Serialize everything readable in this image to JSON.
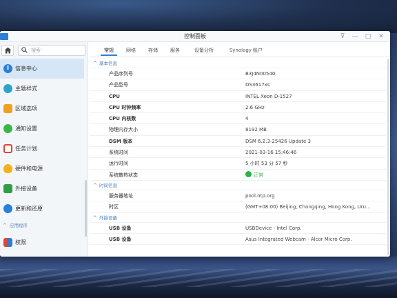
{
  "window": {
    "title": "控制面板",
    "controls": {
      "pin": "⊽",
      "minimize": "—",
      "maximize": "□",
      "close": "✕"
    }
  },
  "sidebar": {
    "search_placeholder": "搜索",
    "items": [
      {
        "label": "信息中心",
        "icon": "info-icon",
        "color": "#2a7fd6",
        "active": true
      },
      {
        "label": "主题样式",
        "icon": "palette-icon",
        "color": "#2ea3c9"
      },
      {
        "label": "区域选项",
        "icon": "region-icon",
        "color": "#f0a020"
      },
      {
        "label": "通知设置",
        "icon": "chat-icon",
        "color": "#3bb54a"
      },
      {
        "label": "任务计划",
        "icon": "calendar-icon",
        "color": "#e0443a"
      },
      {
        "label": "硬件和电源",
        "icon": "bulb-icon",
        "color": "#f3b21b"
      },
      {
        "label": "外接设备",
        "icon": "external-device-icon",
        "color": "#2f9e44"
      },
      {
        "label": "更新和还原",
        "icon": "refresh-icon",
        "color": "#2a7fd6"
      }
    ],
    "section_label": "应用程序",
    "section_items": [
      {
        "label": "权限",
        "icon": "permission-icon",
        "color": "#e0443a"
      }
    ]
  },
  "tabs": [
    "常规",
    "网络",
    "存储",
    "服务",
    "设备分析",
    "Synology 帐户"
  ],
  "active_tab": "常规",
  "sections": [
    {
      "title": "基本信息",
      "rows": [
        {
          "key": "产品序列号",
          "value": "B3J4N00540",
          "bold": false
        },
        {
          "key": "产品型号",
          "value": "DS3617xs",
          "bold": false
        },
        {
          "key": "CPU",
          "value": "INTEL Xeon D-1527",
          "bold": true
        },
        {
          "key": "CPU 时钟频率",
          "value": "2.6 GHz",
          "bold": true
        },
        {
          "key": "CPU 内核数",
          "value": "4",
          "bold": true
        },
        {
          "key": "物理内存大小",
          "value": "8192 MB",
          "bold": false
        },
        {
          "key": "DSM 版本",
          "value": "DSM 6.2.3-25426 Update 3",
          "bold": true
        },
        {
          "key": "系统时间",
          "value": "2021-03-16 15:46:46",
          "bold": false
        },
        {
          "key": "运行时间",
          "value": "5 小时 53 分 57 秒",
          "bold": false
        },
        {
          "key": "系统散热状态",
          "value": "正常",
          "bold": false,
          "status": true
        }
      ]
    },
    {
      "title": "时间信息",
      "rows": [
        {
          "key": "服务器地址",
          "value": "pool.ntp.org",
          "bold": false
        },
        {
          "key": "时区",
          "value": "(GMT+08:00) Beijing, Chongqing, Hong Kong, Uru...",
          "bold": false
        }
      ]
    },
    {
      "title": "外接设备",
      "rows": [
        {
          "key": "USB 设备",
          "value": "USBDevice - Intel Corp.",
          "bold": true
        },
        {
          "key": "USB 设备",
          "value": "Asus Integrated Webcam - Alcor Micro Corp.",
          "bold": true
        }
      ]
    }
  ],
  "colors": {
    "accent": "#2a7fd6",
    "status_ok": "#2bb34a",
    "section_title": "#4a7fb8"
  }
}
